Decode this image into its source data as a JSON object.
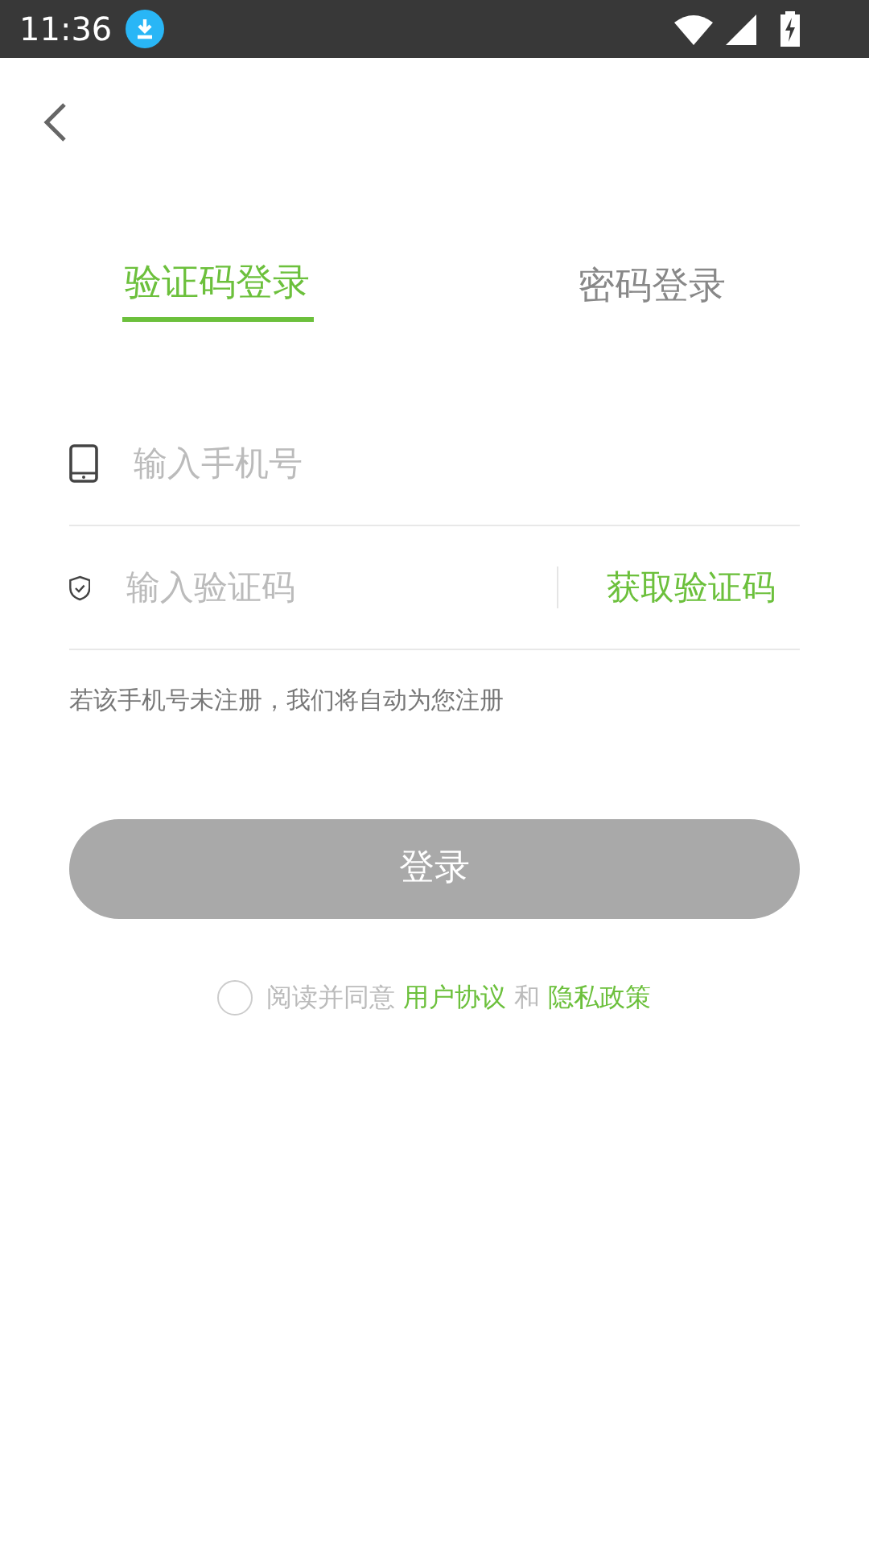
{
  "status_bar": {
    "time": "11:36"
  },
  "tabs": [
    {
      "label": "验证码登录",
      "selected": true
    },
    {
      "label": "密码登录",
      "selected": false
    }
  ],
  "fields": [
    {
      "kind": "phone",
      "placeholder": "输入手机号"
    },
    {
      "kind": "code",
      "placeholder": "输入验证码",
      "action": "获取验证码"
    }
  ],
  "hint": "若该手机号未注册，我们将自动为您注册",
  "login_button": {
    "label": "登录",
    "disabled": true
  },
  "agreement": {
    "checked": false,
    "prefix": "阅读并同意",
    "link_1": "用户协议",
    "joiner": "和",
    "link_2": "隐私政策"
  }
}
